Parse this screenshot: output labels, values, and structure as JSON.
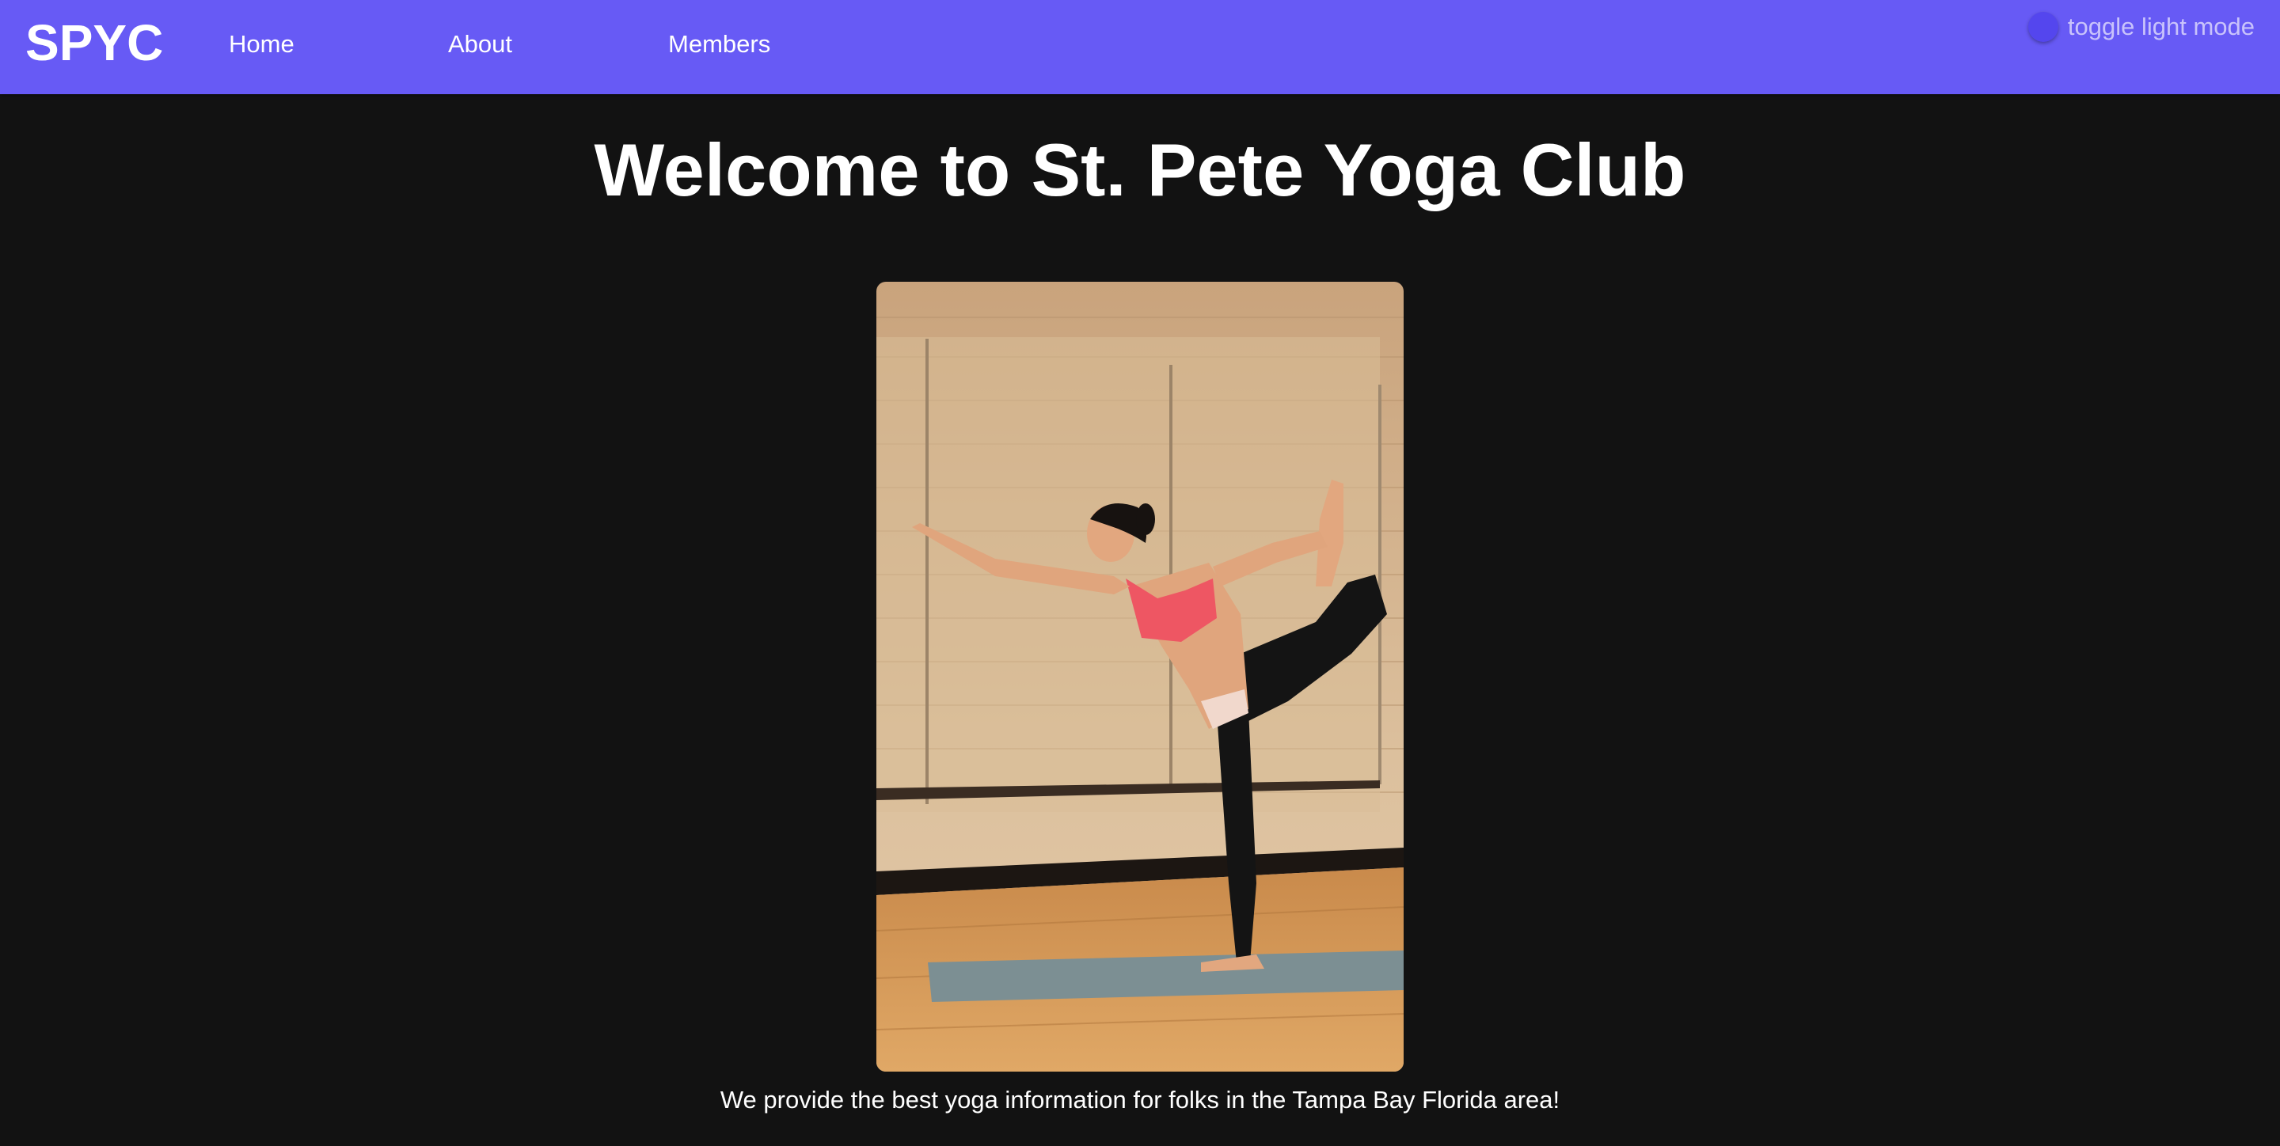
{
  "navbar": {
    "brand": "SPYC",
    "links": [
      "Home",
      "About",
      "Members"
    ],
    "toggle_label": "toggle light mode",
    "background": "#675af5"
  },
  "main": {
    "title": "Welcome to St. Pete Yoga Club",
    "caption": "We provide the best yoga information for folks in the Tampa Bay Florida area!"
  },
  "theme": {
    "page_background": "#121212",
    "toggle_knob": "#5446ee"
  }
}
